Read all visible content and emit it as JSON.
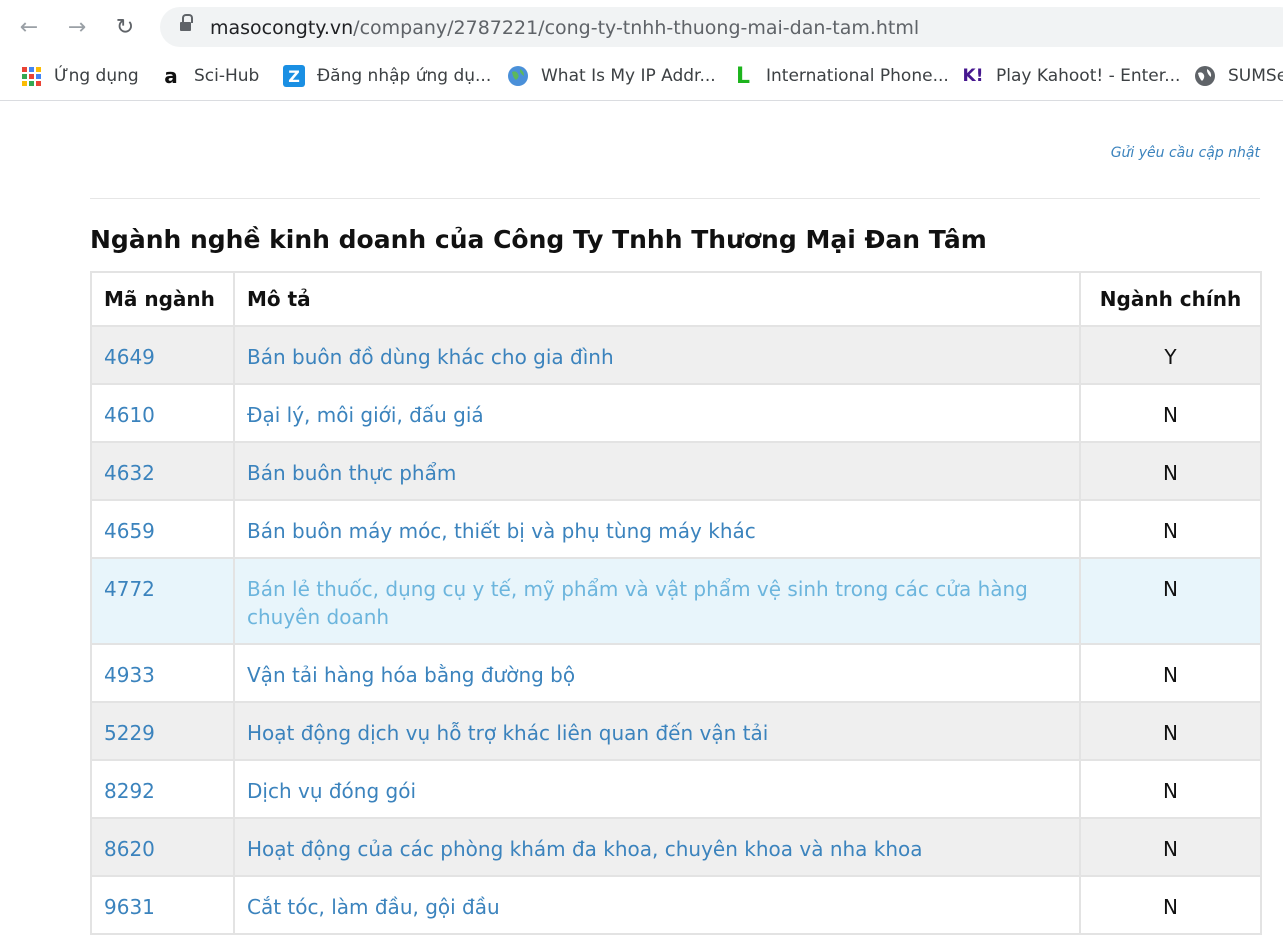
{
  "browser": {
    "url_domain": "masocongty.vn",
    "url_path": "/company/2787221/cong-ty-tnhh-thuong-mai-dan-tam.html",
    "bookmarks": [
      {
        "label": "Ứng dụng",
        "icon": "apps-grid-icon"
      },
      {
        "label": "Sci-Hub",
        "icon": "amazon-icon"
      },
      {
        "label": "Đăng nhập ứng dụ...",
        "icon": "zalo-icon"
      },
      {
        "label": "What Is My IP Addr...",
        "icon": "globe-icon"
      },
      {
        "label": "International Phone...",
        "icon": "l-logo-icon"
      },
      {
        "label": "Play Kahoot! - Enter...",
        "icon": "kahoot-icon"
      },
      {
        "label": "SUMSe",
        "icon": "world-icon"
      }
    ]
  },
  "page": {
    "update_link": "Gửi yêu cầu cập nhật",
    "section_title": "Ngành nghề kinh doanh của Công Ty Tnhh Thương Mại Đan Tâm",
    "table": {
      "headers": {
        "code": "Mã ngành",
        "desc": "Mô tả",
        "main": "Ngành chính"
      },
      "rows": [
        {
          "code": "4649",
          "desc": "Bán buôn đồ dùng khác cho gia đình",
          "main": "Y"
        },
        {
          "code": "4610",
          "desc": "Đại lý, môi giới, đấu giá",
          "main": "N"
        },
        {
          "code": "4632",
          "desc": "Bán buôn thực phẩm",
          "main": "N"
        },
        {
          "code": "4659",
          "desc": "Bán buôn máy móc, thiết bị và phụ tùng máy khác",
          "main": "N"
        },
        {
          "code": "4772",
          "desc": "Bán lẻ thuốc, dụng cụ y tế, mỹ phẩm và vật phẩm vệ sinh trong các cửa hàng chuyên doanh",
          "main": "N"
        },
        {
          "code": "4933",
          "desc": "Vận tải hàng hóa bằng đường bộ",
          "main": "N"
        },
        {
          "code": "5229",
          "desc": "Hoạt động dịch vụ hỗ trợ khác liên quan đến vận tải",
          "main": "N"
        },
        {
          "code": "8292",
          "desc": "Dịch vụ đóng gói",
          "main": "N"
        },
        {
          "code": "8620",
          "desc": "Hoạt động của các phòng khám đa khoa, chuyên khoa và nha khoa",
          "main": "N"
        },
        {
          "code": "9631",
          "desc": "Cắt tóc, làm đầu, gội đầu",
          "main": "N"
        }
      ]
    }
  },
  "colors": {
    "link": "#3b83bd",
    "row_alt": "#efefef",
    "row_hover": "#e8f5fb"
  }
}
